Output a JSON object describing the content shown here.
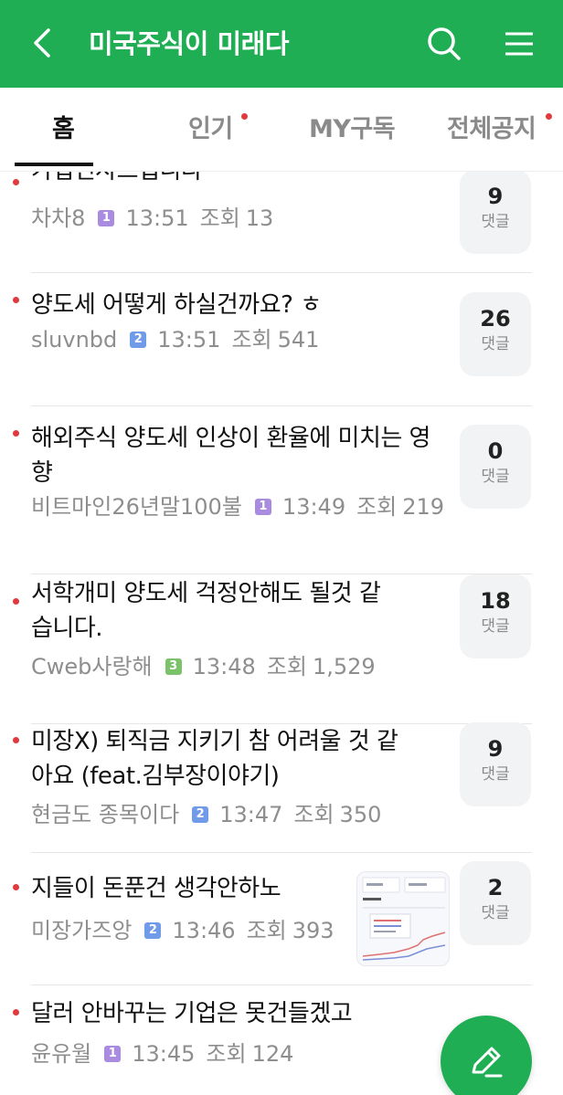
{
  "header": {
    "title": "미국주식이 미래다",
    "back_icon": "chevron-left-icon",
    "search_icon": "search-icon",
    "menu_icon": "hamburger-menu-icon",
    "bg_color": "#1fae54"
  },
  "tabs": [
    {
      "label": "홈",
      "active": true,
      "new_dot": false
    },
    {
      "label": "인기",
      "active": false,
      "new_dot": true
    },
    {
      "label": "MY구독",
      "active": false,
      "new_dot": false
    },
    {
      "label": "전체공지",
      "active": false,
      "new_dot": true
    }
  ],
  "posts": [
    {
      "title": "가입인사드립니다",
      "author": "차차8",
      "level": "1",
      "time": "13:51",
      "views_label": "조회",
      "views": "13",
      "comments": "9",
      "comments_label": "댓글"
    },
    {
      "title": "양도세 어떻게 하실건까요? ㅎ",
      "author": "sluvnbd",
      "level": "2",
      "time": "13:51",
      "views_label": "조회",
      "views": "541",
      "comments": "26",
      "comments_label": "댓글"
    },
    {
      "title": "해외주식 양도세 인상이 환율에 미치는 영향",
      "author": "비트마인26년말100불",
      "level": "1",
      "time": "13:49",
      "views_label": "조회",
      "views": "219",
      "comments": "0",
      "comments_label": "댓글"
    },
    {
      "title": "서학개미 양도세 걱정안해도 될것 같습니다.",
      "author": "Cweb사랑해",
      "level": "3",
      "time": "13:48",
      "views_label": "조회",
      "views": "1,529",
      "comments": "18",
      "comments_label": "댓글"
    },
    {
      "title": "미장X) 퇴직금 지키기 참 어려울 것 같아요 (feat.김부장이야기)",
      "author": "현금도 종목이다",
      "level": "2",
      "time": "13:47",
      "views_label": "조회",
      "views": "350",
      "comments": "9",
      "comments_label": "댓글"
    },
    {
      "title": "지들이 돈푼건 생각안하노",
      "author": "미장가즈앙",
      "level": "2",
      "time": "13:46",
      "views_label": "조회",
      "views": "393",
      "comments": "2",
      "comments_label": "댓글",
      "has_thumbnail": true
    },
    {
      "title": "달러 안바꾸는 기업은 못건들겠고",
      "author": "윤유월",
      "level": "1",
      "time": "13:45",
      "views_label": "조회",
      "views": "124"
    }
  ],
  "fab": {
    "icon": "pencil-write-icon"
  }
}
